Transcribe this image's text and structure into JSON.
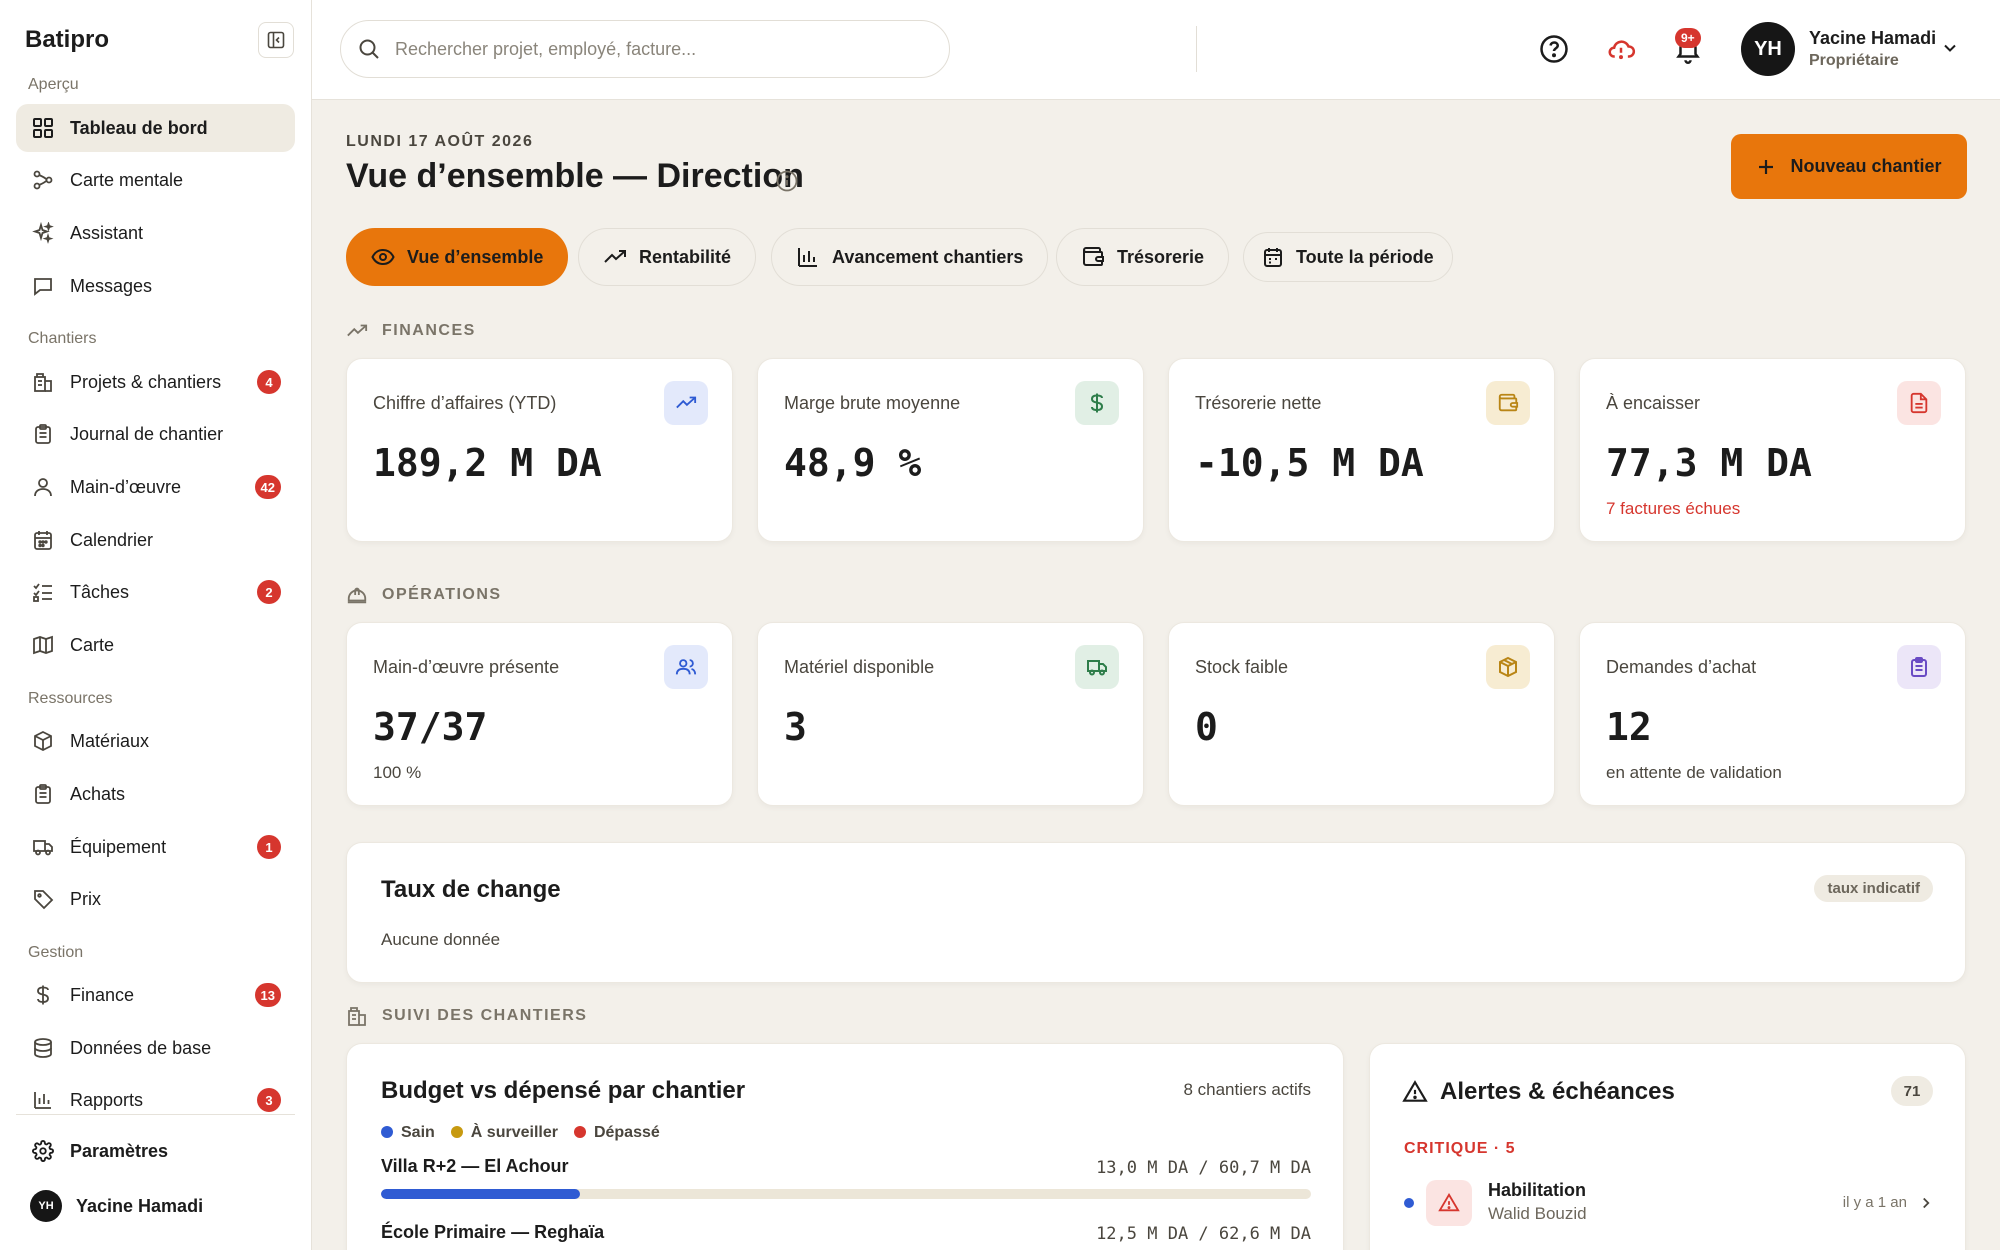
{
  "sidebar": {
    "brand": "Batipro",
    "sections": {
      "apercu": "Aperçu",
      "chantiers": "Chantiers",
      "ressources": "Ressources",
      "gestion": "Gestion"
    },
    "items": {
      "tableau": "Tableau de bord",
      "carte_mentale": "Carte mentale",
      "assistant": "Assistant",
      "messages": "Messages",
      "projets": "Projets & chantiers",
      "journal": "Journal de chantier",
      "main_oeuvre": "Main-d’œuvre",
      "calendrier": "Calendrier",
      "taches": "Tâches",
      "carte": "Carte",
      "materiaux": "Matériaux",
      "achats": "Achats",
      "equipement": "Équipement",
      "prix": "Prix",
      "finance": "Finance",
      "donnees": "Données de base",
      "rapports": "Rapports",
      "parametres": "Paramètres"
    },
    "badges": {
      "projets": "4",
      "main_oeuvre": "42",
      "taches": "2",
      "equipement": "1",
      "finance": "13",
      "rapports": "3"
    },
    "footer_user": {
      "initials": "YH",
      "name": "Yacine Hamadi"
    }
  },
  "topbar": {
    "search_placeholder": "Rechercher projet, employé, facture...",
    "notif_badge": "9+",
    "user": {
      "initials": "YH",
      "name": "Yacine Hamadi",
      "role": "Propriétaire"
    }
  },
  "header": {
    "date": "LUNDI 17 AOÛT 2026",
    "title": "Vue d’ensemble — Direction",
    "new_button": "Nouveau chantier"
  },
  "tabs": {
    "overview": "Vue d’ensemble",
    "rentabilite": "Rentabilité",
    "avancement": "Avancement chantiers",
    "tresorerie": "Trésorerie",
    "periode": "Toute la période"
  },
  "finances": {
    "heading": "FINANCES",
    "ca": {
      "label": "Chiffre d’affaires (YTD)",
      "value": "189,2 M DA"
    },
    "marge": {
      "label": "Marge brute moyenne",
      "value": "48,9 %"
    },
    "treso": {
      "label": "Trésorerie nette",
      "value": "-10,5 M DA"
    },
    "encaisser": {
      "label": "À encaisser",
      "value": "77,3 M DA",
      "sub": "7 factures échues"
    }
  },
  "operations": {
    "heading": "OPÉRATIONS",
    "presence": {
      "label": "Main-d’œuvre présente",
      "value": "37/37",
      "sub": "100 %"
    },
    "materiel": {
      "label": "Matériel disponible",
      "value": "3"
    },
    "stock": {
      "label": "Stock faible",
      "value": "0"
    },
    "demandes": {
      "label": "Demandes d’achat",
      "value": "12",
      "sub": "en attente de validation"
    }
  },
  "exchange": {
    "title": "Taux de change",
    "tag": "taux indicatif",
    "empty": "Aucune donnée"
  },
  "suivi": {
    "heading": "SUIVI DES CHANTIERS",
    "budget": {
      "title": "Budget vs dépensé par chantier",
      "count": "8 chantiers actifs",
      "legend": {
        "sain": "Sain",
        "surveiller": "À surveiller",
        "depasse": "Dépassé"
      },
      "rows": [
        {
          "name": "Villa R+2 — El Achour",
          "value": "13,0 M DA / 60,7 M DA",
          "ratio": 0.214
        },
        {
          "name": "École Primaire — Reghaïa",
          "value": "12,5 M DA / 62,6 M DA",
          "ratio": 0.2
        }
      ]
    },
    "alerts": {
      "title": "Alertes & échéances",
      "count": "71",
      "critical_label": "CRITIQUE · 5",
      "items": [
        {
          "title": "Habilitation",
          "person": "Walid Bouzid",
          "time": "il y a 1 an"
        }
      ]
    }
  },
  "colors": {
    "accent": "#e8760c",
    "danger": "#d6362e",
    "healthy": "#2f5bd3",
    "watch": "#c79a10"
  }
}
